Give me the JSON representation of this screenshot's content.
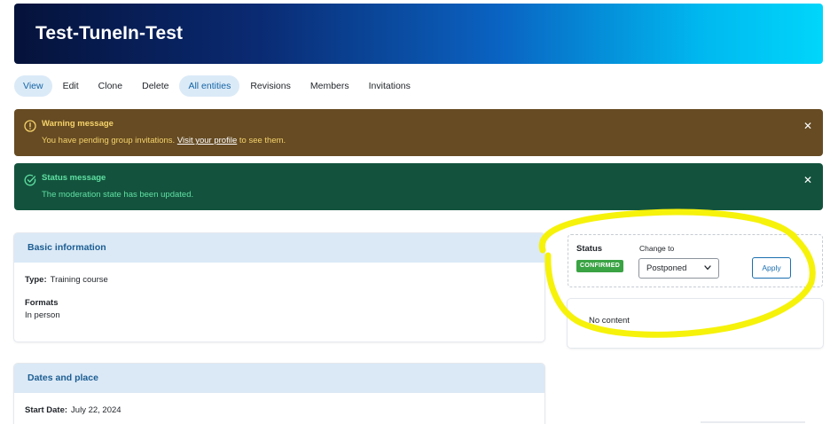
{
  "page": {
    "title": "Test-TuneIn-Test"
  },
  "tabs": [
    {
      "label": "View",
      "active": true
    },
    {
      "label": "Edit",
      "active": false
    },
    {
      "label": "Clone",
      "active": false
    },
    {
      "label": "Delete",
      "active": false
    },
    {
      "label": "All entities",
      "active": true
    },
    {
      "label": "Revisions",
      "active": false
    },
    {
      "label": "Members",
      "active": false
    },
    {
      "label": "Invitations",
      "active": false
    }
  ],
  "warning": {
    "title": "Warning message",
    "text_before": "You have pending group invitations. ",
    "link": "Visit your profile",
    "text_after": " to see them.",
    "close": "✕"
  },
  "status_message": {
    "title": "Status message",
    "text": "The moderation state has been updated.",
    "close": "✕"
  },
  "basic_info": {
    "heading": "Basic information",
    "type_label": "Type:",
    "type_value": "Training course",
    "formats_label": "Formats",
    "formats_value": "In person"
  },
  "dates": {
    "heading": "Dates and place",
    "start_label": "Start Date:",
    "start_value": "July 22, 2024"
  },
  "moderation": {
    "status_label": "Status",
    "status_badge": "CONFIRMED",
    "change_label": "Change to",
    "selected": "Postponed",
    "apply": "Apply"
  },
  "sidebar": {
    "no_content": "No content"
  },
  "colors": {
    "warning_bg": "#664b23",
    "status_bg": "#13533d",
    "badge_green": "#3aa344",
    "accent_blue": "#1b6fb0",
    "highlight": "#f6f20a"
  },
  "icons": {
    "warning": "warning-circle-icon",
    "status": "check-circle-icon",
    "close": "close-icon",
    "dropdown": "chevron-down-icon"
  }
}
